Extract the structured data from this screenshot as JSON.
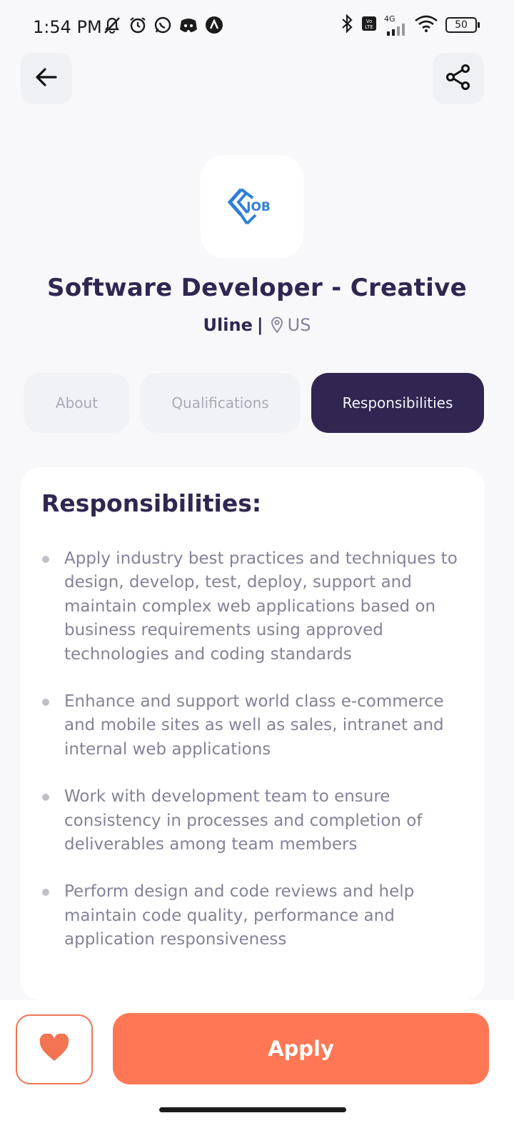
{
  "status_bar": {
    "time": "1:54 PM",
    "network": "4G",
    "battery": "50",
    "icons": [
      "mute-icon",
      "alarm-icon",
      "whatsapp-icon",
      "discord-icon",
      "app-icon",
      "bluetooth-icon",
      "volte-icon",
      "signal-icon",
      "wifi-icon",
      "battery-icon"
    ]
  },
  "header": {
    "back_icon": "arrow-left-icon",
    "share_icon": "share-icon"
  },
  "company_logo": {
    "text": "JOB",
    "color": "#2f7fd8"
  },
  "job": {
    "title": "Software Developer - Creative",
    "company": "Uline",
    "separator": "|",
    "location": "US"
  },
  "tabs": [
    {
      "label": "About",
      "active": false
    },
    {
      "label": "Qualifications",
      "active": false
    },
    {
      "label": "Responsibilities",
      "active": true
    }
  ],
  "content": {
    "title": "Responsibilities:",
    "points": [
      "Apply industry best practices and techniques to design, develop, test, deploy, support and maintain complex web applications based on business requirements using approved technologies and coding standards",
      "Enhance and support world class e-commerce and mobile sites as well as sales, intranet and internal web applications",
      "Work with development team to ensure consistency in processes and completion of deliverables among team members",
      "Perform design and code reviews and help maintain code quality, performance and application responsiveness"
    ]
  },
  "footer": {
    "like_icon": "heart-icon",
    "apply_label": "Apply"
  },
  "colors": {
    "primary": "#312651",
    "accent": "#ff7754",
    "gray": "#83829a",
    "background": "#f8f8fb"
  }
}
